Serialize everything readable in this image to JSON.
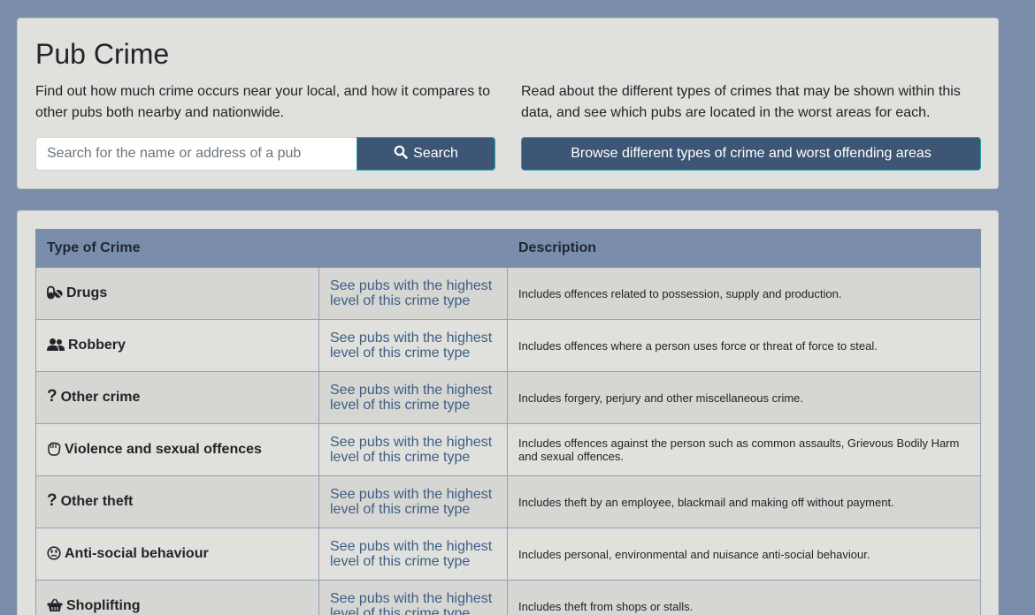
{
  "header": {
    "title": "Pub Crime",
    "lead_left": "Find out how much crime occurs near your local, and how it compares to other pubs both nearby and nationwide.",
    "lead_right": "Read about the different types of crimes that may be shown within this data, and see which pubs are located in the worst areas for each.",
    "search_placeholder": "Search for the name or address of a pub",
    "search_value": "",
    "search_button_label": "Search",
    "browse_button_label": "Browse different types of crime and worst offending areas"
  },
  "table": {
    "headers": {
      "type": "Type of Crime",
      "description": "Description"
    },
    "rows": [
      {
        "icon": "pills-icon",
        "type": "Drugs",
        "link": "See pubs with the highest level of this crime type",
        "description": "Includes offences related to possession, supply and production."
      },
      {
        "icon": "users-icon",
        "type": "Robbery",
        "link": "See pubs with the highest level of this crime type",
        "description": "Includes offences where a person uses force or threat of force to steal."
      },
      {
        "icon": "question-icon",
        "type": "Other crime",
        "link": "See pubs with the highest level of this crime type",
        "description": "Includes forgery, perjury and other miscellaneous crime."
      },
      {
        "icon": "fist-icon",
        "type": "Violence and sexual offences",
        "link": "See pubs with the highest level of this crime type",
        "description": "Includes offences against the person such as common assaults, Grievous Bodily Harm and sexual offences."
      },
      {
        "icon": "question-icon",
        "type": "Other theft",
        "link": "See pubs with the highest level of this crime type",
        "description": "Includes theft by an employee, blackmail and making off without payment."
      },
      {
        "icon": "angry-face-icon",
        "type": "Anti-social behaviour",
        "link": "See pubs with the highest level of this crime type",
        "description": "Includes personal, environmental and nuisance anti-social behaviour."
      },
      {
        "icon": "basket-icon",
        "type": "Shoplifting",
        "link": "See pubs with the highest level of this crime type",
        "description": "Includes theft from shops or stalls."
      }
    ]
  },
  "colors": {
    "background": "#7a8dab",
    "card": "#e0e0dc",
    "button": "#3d5675",
    "link": "#3d5e87",
    "table_header": "#7a8dab"
  }
}
